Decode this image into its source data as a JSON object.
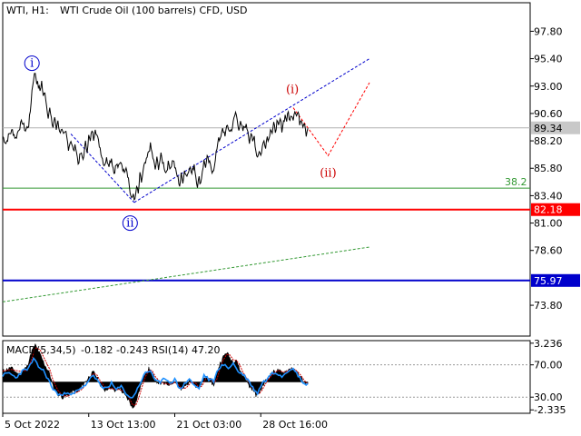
{
  "chart_data": [
    {
      "type": "line",
      "header": {
        "symbol": "WTI, H1:",
        "description": "WTI Crude Oil (100 barrels) CFD, USD"
      },
      "y_ticks": [
        {
          "value": 97.8,
          "label": "97.80"
        },
        {
          "value": 95.4,
          "label": "95.40"
        },
        {
          "value": 93.0,
          "label": "93.00"
        },
        {
          "value": 90.6,
          "label": "90.60"
        },
        {
          "value": 88.2,
          "label": "88.20"
        },
        {
          "value": 85.8,
          "label": "85.80"
        },
        {
          "value": 83.4,
          "label": "83.40"
        },
        {
          "value": 81.0,
          "label": "81.00"
        },
        {
          "value": 78.6,
          "label": "78.60"
        },
        {
          "value": 73.8,
          "label": "73.80"
        }
      ],
      "ylim": [
        71.1,
        100.3
      ],
      "x_ticks": [
        {
          "index": 0,
          "label": "5 Oct 2022"
        },
        {
          "index": 106,
          "label": "13 Oct 13:00"
        },
        {
          "index": 212,
          "label": "21 Oct 03:00"
        },
        {
          "index": 318,
          "label": "28 Oct 16:00"
        }
      ],
      "x_count": 650,
      "price_points": [
        [
          0,
          88.6
        ],
        [
          4,
          88.0
        ],
        [
          8,
          88.8
        ],
        [
          12,
          89.1
        ],
        [
          16,
          88.4
        ],
        [
          20,
          89.3
        ],
        [
          24,
          89.9
        ],
        [
          28,
          89.1
        ],
        [
          32,
          89.6
        ],
        [
          34,
          90.8
        ],
        [
          36,
          92.6
        ],
        [
          38,
          93.7
        ],
        [
          40,
          94.2
        ],
        [
          42,
          93.4
        ],
        [
          44,
          93.0
        ],
        [
          46,
          92.6
        ],
        [
          48,
          93.4
        ],
        [
          50,
          92.0
        ],
        [
          52,
          92.6
        ],
        [
          54,
          91.3
        ],
        [
          56,
          90.4
        ],
        [
          58,
          91.0
        ],
        [
          60,
          90.0
        ],
        [
          62,
          89.4
        ],
        [
          64,
          90.3
        ],
        [
          66,
          89.2
        ],
        [
          68,
          90.1
        ],
        [
          70,
          88.9
        ],
        [
          72,
          89.3
        ],
        [
          75,
          88.6
        ],
        [
          78,
          88.9
        ],
        [
          81,
          87.6
        ],
        [
          84,
          88.3
        ],
        [
          87,
          87.3
        ],
        [
          90,
          87.8
        ],
        [
          93,
          86.2
        ],
        [
          96,
          87.1
        ],
        [
          99,
          86.6
        ],
        [
          102,
          88.0
        ],
        [
          104,
          87.4
        ],
        [
          106,
          88.6
        ],
        [
          108,
          88.1
        ],
        [
          110,
          89.2
        ],
        [
          112,
          88.4
        ],
        [
          114,
          89.4
        ],
        [
          116,
          88.7
        ],
        [
          118,
          88.1
        ],
        [
          120,
          87.6
        ],
        [
          122,
          86.9
        ],
        [
          125,
          86.1
        ],
        [
          128,
          86.6
        ],
        [
          131,
          86.2
        ],
        [
          134,
          86.7
        ],
        [
          137,
          85.4
        ],
        [
          140,
          86.1
        ],
        [
          143,
          85.9
        ],
        [
          146,
          86.4
        ],
        [
          149,
          85.5
        ],
        [
          152,
          86.0
        ],
        [
          155,
          84.9
        ],
        [
          157,
          83.7
        ],
        [
          159,
          83.0
        ],
        [
          161,
          83.6
        ],
        [
          163,
          82.9
        ],
        [
          165,
          84.2
        ],
        [
          167,
          83.5
        ],
        [
          169,
          85.2
        ],
        [
          171,
          84.6
        ],
        [
          174,
          85.9
        ],
        [
          177,
          86.4
        ],
        [
          180,
          87.3
        ],
        [
          182,
          87.8
        ],
        [
          184,
          87.1
        ],
        [
          186,
          86.4
        ],
        [
          188,
          85.7
        ],
        [
          190,
          86.6
        ],
        [
          192,
          85.9
        ],
        [
          195,
          86.9
        ],
        [
          198,
          86.2
        ],
        [
          201,
          85.4
        ],
        [
          204,
          86.2
        ],
        [
          207,
          85.9
        ],
        [
          210,
          86.6
        ],
        [
          213,
          85.6
        ],
        [
          216,
          84.9
        ],
        [
          218,
          84.3
        ],
        [
          220,
          85.2
        ],
        [
          222,
          84.7
        ],
        [
          224,
          85.6
        ],
        [
          227,
          85.1
        ],
        [
          230,
          86.0
        ],
        [
          233,
          85.3
        ],
        [
          236,
          86.2
        ],
        [
          238,
          85.1
        ],
        [
          240,
          84.3
        ],
        [
          242,
          84.9
        ],
        [
          244,
          84.5
        ],
        [
          246,
          85.6
        ],
        [
          248,
          86.4
        ],
        [
          250,
          86.0
        ],
        [
          252,
          86.7
        ],
        [
          255,
          86.2
        ],
        [
          258,
          85.6
        ],
        [
          261,
          85.9
        ],
        [
          264,
          87.6
        ],
        [
          266,
          88.6
        ],
        [
          268,
          88.2
        ],
        [
          271,
          89.2
        ],
        [
          274,
          88.8
        ],
        [
          277,
          89.5
        ],
        [
          280,
          89.0
        ],
        [
          283,
          89.4
        ],
        [
          285,
          90.1
        ],
        [
          287,
          90.7
        ],
        [
          289,
          90.1
        ],
        [
          291,
          89.3
        ],
        [
          293,
          89.7
        ],
        [
          296,
          89.1
        ],
        [
          299,
          89.6
        ],
        [
          302,
          89.2
        ],
        [
          304,
          88.2
        ],
        [
          306,
          88.9
        ],
        [
          308,
          88.0
        ],
        [
          310,
          88.6
        ],
        [
          312,
          87.3
        ],
        [
          314,
          86.8
        ],
        [
          316,
          87.4
        ],
        [
          318,
          86.9
        ],
        [
          320,
          87.7
        ],
        [
          322,
          88.2
        ],
        [
          324,
          87.8
        ],
        [
          326,
          88.6
        ],
        [
          328,
          88.3
        ],
        [
          330,
          89.4
        ],
        [
          332,
          88.9
        ],
        [
          334,
          89.6
        ],
        [
          336,
          89.1
        ],
        [
          338,
          89.8
        ],
        [
          340,
          89.4
        ],
        [
          342,
          90.1
        ],
        [
          344,
          89.2
        ],
        [
          346,
          89.9
        ],
        [
          348,
          90.4
        ],
        [
          350,
          90.0
        ],
        [
          352,
          90.7
        ],
        [
          354,
          89.9
        ],
        [
          356,
          90.6
        ],
        [
          358,
          90.2
        ],
        [
          360,
          91.0
        ],
        [
          362,
          90.4
        ],
        [
          364,
          90.7
        ],
        [
          366,
          89.8
        ],
        [
          368,
          90.2
        ],
        [
          370,
          89.6
        ],
        [
          372,
          89.9
        ],
        [
          374,
          88.8
        ],
        [
          376,
          89.3
        ]
      ],
      "current_price": {
        "value": 89.34,
        "label": "89.34"
      },
      "levels": [
        {
          "value": 84.06,
          "color": "#339933",
          "label": "38.2",
          "style": "thin"
        },
        {
          "value": 82.18,
          "color": "#ff0000",
          "label": "82.18",
          "style": "thick"
        },
        {
          "value": 75.97,
          "color": "#0000cc",
          "label": "75.97",
          "style": "thick"
        }
      ],
      "trend_lines": [
        {
          "color": "#0000cc",
          "dash": true,
          "points": [
            [
              84,
              88.8
            ],
            [
              162,
              82.8
            ]
          ]
        },
        {
          "color": "#0000cc",
          "dash": true,
          "points": [
            [
              162,
              82.8
            ],
            [
              452,
              95.4
            ]
          ]
        },
        {
          "color": "#339933",
          "dash": true,
          "points": [
            [
              0,
              74.1
            ],
            [
              452,
              78.9
            ]
          ]
        },
        {
          "color": "#ff0000",
          "dash": true,
          "points": [
            [
              358,
              91.1
            ],
            [
              401,
              86.9
            ],
            [
              452,
              93.3
            ]
          ]
        }
      ],
      "wave_labels": [
        {
          "text": "i",
          "color": "#0000cc",
          "circled": true,
          "at": [
            36,
            95.0
          ]
        },
        {
          "text": "ii",
          "color": "#0000cc",
          "circled": true,
          "at": [
            157,
            81.0
          ]
        },
        {
          "text": "(i)",
          "color": "#cc0000",
          "circled": false,
          "at": [
            357,
            92.7
          ]
        },
        {
          "text": "(ii)",
          "color": "#cc0000",
          "circled": false,
          "at": [
            401,
            85.4
          ]
        }
      ]
    },
    {
      "type": "area",
      "header": {
        "macd_label": "MACD(5,34,5)",
        "macd_value1": "-0.182",
        "macd_value2": "-0.243",
        "rsi_label": "RSI(14)",
        "rsi_value": "47.20"
      },
      "y_ticks": [
        {
          "value": 3.236,
          "label": "3.236"
        },
        {
          "value": 70,
          "label": "70.00"
        },
        {
          "value": 30,
          "label": "30.00"
        },
        {
          "value": -2.335,
          "label": "-2.335"
        }
      ],
      "macd_ylim": [
        -2.62,
        3.45
      ],
      "rsi_ylim": [
        10,
        100
      ],
      "macd_hist": [
        [
          0,
          0.9
        ],
        [
          10,
          1.2
        ],
        [
          20,
          0.6
        ],
        [
          30,
          1.3
        ],
        [
          36,
          2.6
        ],
        [
          40,
          3.1
        ],
        [
          46,
          2.3
        ],
        [
          52,
          1.4
        ],
        [
          58,
          0.7
        ],
        [
          62,
          -0.4
        ],
        [
          68,
          -1.0
        ],
        [
          74,
          -1.3
        ],
        [
          80,
          -1.1
        ],
        [
          86,
          -0.8
        ],
        [
          92,
          -0.9
        ],
        [
          98,
          -0.3
        ],
        [
          104,
          0.2
        ],
        [
          108,
          0.6
        ],
        [
          112,
          0.8
        ],
        [
          116,
          0.4
        ],
        [
          120,
          -0.2
        ],
        [
          126,
          -0.7
        ],
        [
          132,
          -0.4
        ],
        [
          138,
          -0.8
        ],
        [
          144,
          -0.5
        ],
        [
          150,
          -1.1
        ],
        [
          156,
          -1.6
        ],
        [
          160,
          -2.2
        ],
        [
          164,
          -1.7
        ],
        [
          168,
          -0.8
        ],
        [
          172,
          0.1
        ],
        [
          176,
          0.8
        ],
        [
          180,
          1.1
        ],
        [
          184,
          0.8
        ],
        [
          188,
          0.1
        ],
        [
          194,
          -0.1
        ],
        [
          200,
          -0.2
        ],
        [
          206,
          -0.2
        ],
        [
          212,
          0.1
        ],
        [
          216,
          -0.4
        ],
        [
          220,
          -0.7
        ],
        [
          226,
          -0.3
        ],
        [
          232,
          0.2
        ],
        [
          238,
          -0.4
        ],
        [
          242,
          -0.6
        ],
        [
          246,
          0.0
        ],
        [
          250,
          0.5
        ],
        [
          256,
          0.1
        ],
        [
          260,
          -0.3
        ],
        [
          264,
          0.8
        ],
        [
          268,
          1.6
        ],
        [
          272,
          2.1
        ],
        [
          276,
          2.5
        ],
        [
          280,
          2.0
        ],
        [
          284,
          1.7
        ],
        [
          288,
          1.9
        ],
        [
          292,
          1.0
        ],
        [
          296,
          0.6
        ],
        [
          300,
          0.2
        ],
        [
          304,
          -0.4
        ],
        [
          308,
          -0.6
        ],
        [
          312,
          -1.1
        ],
        [
          316,
          -0.9
        ],
        [
          320,
          -0.4
        ],
        [
          324,
          0.1
        ],
        [
          328,
          0.4
        ],
        [
          332,
          0.8
        ],
        [
          336,
          0.9
        ],
        [
          340,
          1.0
        ],
        [
          344,
          0.7
        ],
        [
          348,
          0.9
        ],
        [
          352,
          1.0
        ],
        [
          356,
          1.2
        ],
        [
          360,
          0.9
        ],
        [
          364,
          0.7
        ],
        [
          368,
          0.3
        ],
        [
          372,
          -0.1
        ],
        [
          376,
          -0.2
        ]
      ],
      "rsi_line": [
        [
          0,
          57
        ],
        [
          8,
          60
        ],
        [
          16,
          54
        ],
        [
          24,
          62
        ],
        [
          32,
          66
        ],
        [
          38,
          77
        ],
        [
          44,
          68
        ],
        [
          50,
          63
        ],
        [
          56,
          52
        ],
        [
          62,
          40
        ],
        [
          68,
          34
        ],
        [
          74,
          32
        ],
        [
          80,
          37
        ],
        [
          86,
          33
        ],
        [
          92,
          38
        ],
        [
          98,
          41
        ],
        [
          104,
          48
        ],
        [
          110,
          57
        ],
        [
          116,
          52
        ],
        [
          122,
          41
        ],
        [
          128,
          42
        ],
        [
          134,
          47
        ],
        [
          140,
          39
        ],
        [
          146,
          43
        ],
        [
          152,
          35
        ],
        [
          158,
          28
        ],
        [
          164,
          36
        ],
        [
          170,
          49
        ],
        [
          176,
          60
        ],
        [
          182,
          63
        ],
        [
          188,
          51
        ],
        [
          194,
          47
        ],
        [
          200,
          54
        ],
        [
          206,
          48
        ],
        [
          212,
          52
        ],
        [
          218,
          40
        ],
        [
          224,
          46
        ],
        [
          230,
          53
        ],
        [
          236,
          44
        ],
        [
          242,
          41
        ],
        [
          248,
          57
        ],
        [
          254,
          52
        ],
        [
          260,
          50
        ],
        [
          266,
          66
        ],
        [
          272,
          70
        ],
        [
          278,
          66
        ],
        [
          284,
          72
        ],
        [
          290,
          62
        ],
        [
          296,
          58
        ],
        [
          302,
          52
        ],
        [
          308,
          42
        ],
        [
          314,
          35
        ],
        [
          320,
          48
        ],
        [
          326,
          52
        ],
        [
          332,
          61
        ],
        [
          338,
          60
        ],
        [
          344,
          56
        ],
        [
          350,
          62
        ],
        [
          356,
          66
        ],
        [
          362,
          60
        ],
        [
          368,
          51
        ],
        [
          374,
          45
        ],
        [
          376,
          47
        ]
      ]
    }
  ]
}
